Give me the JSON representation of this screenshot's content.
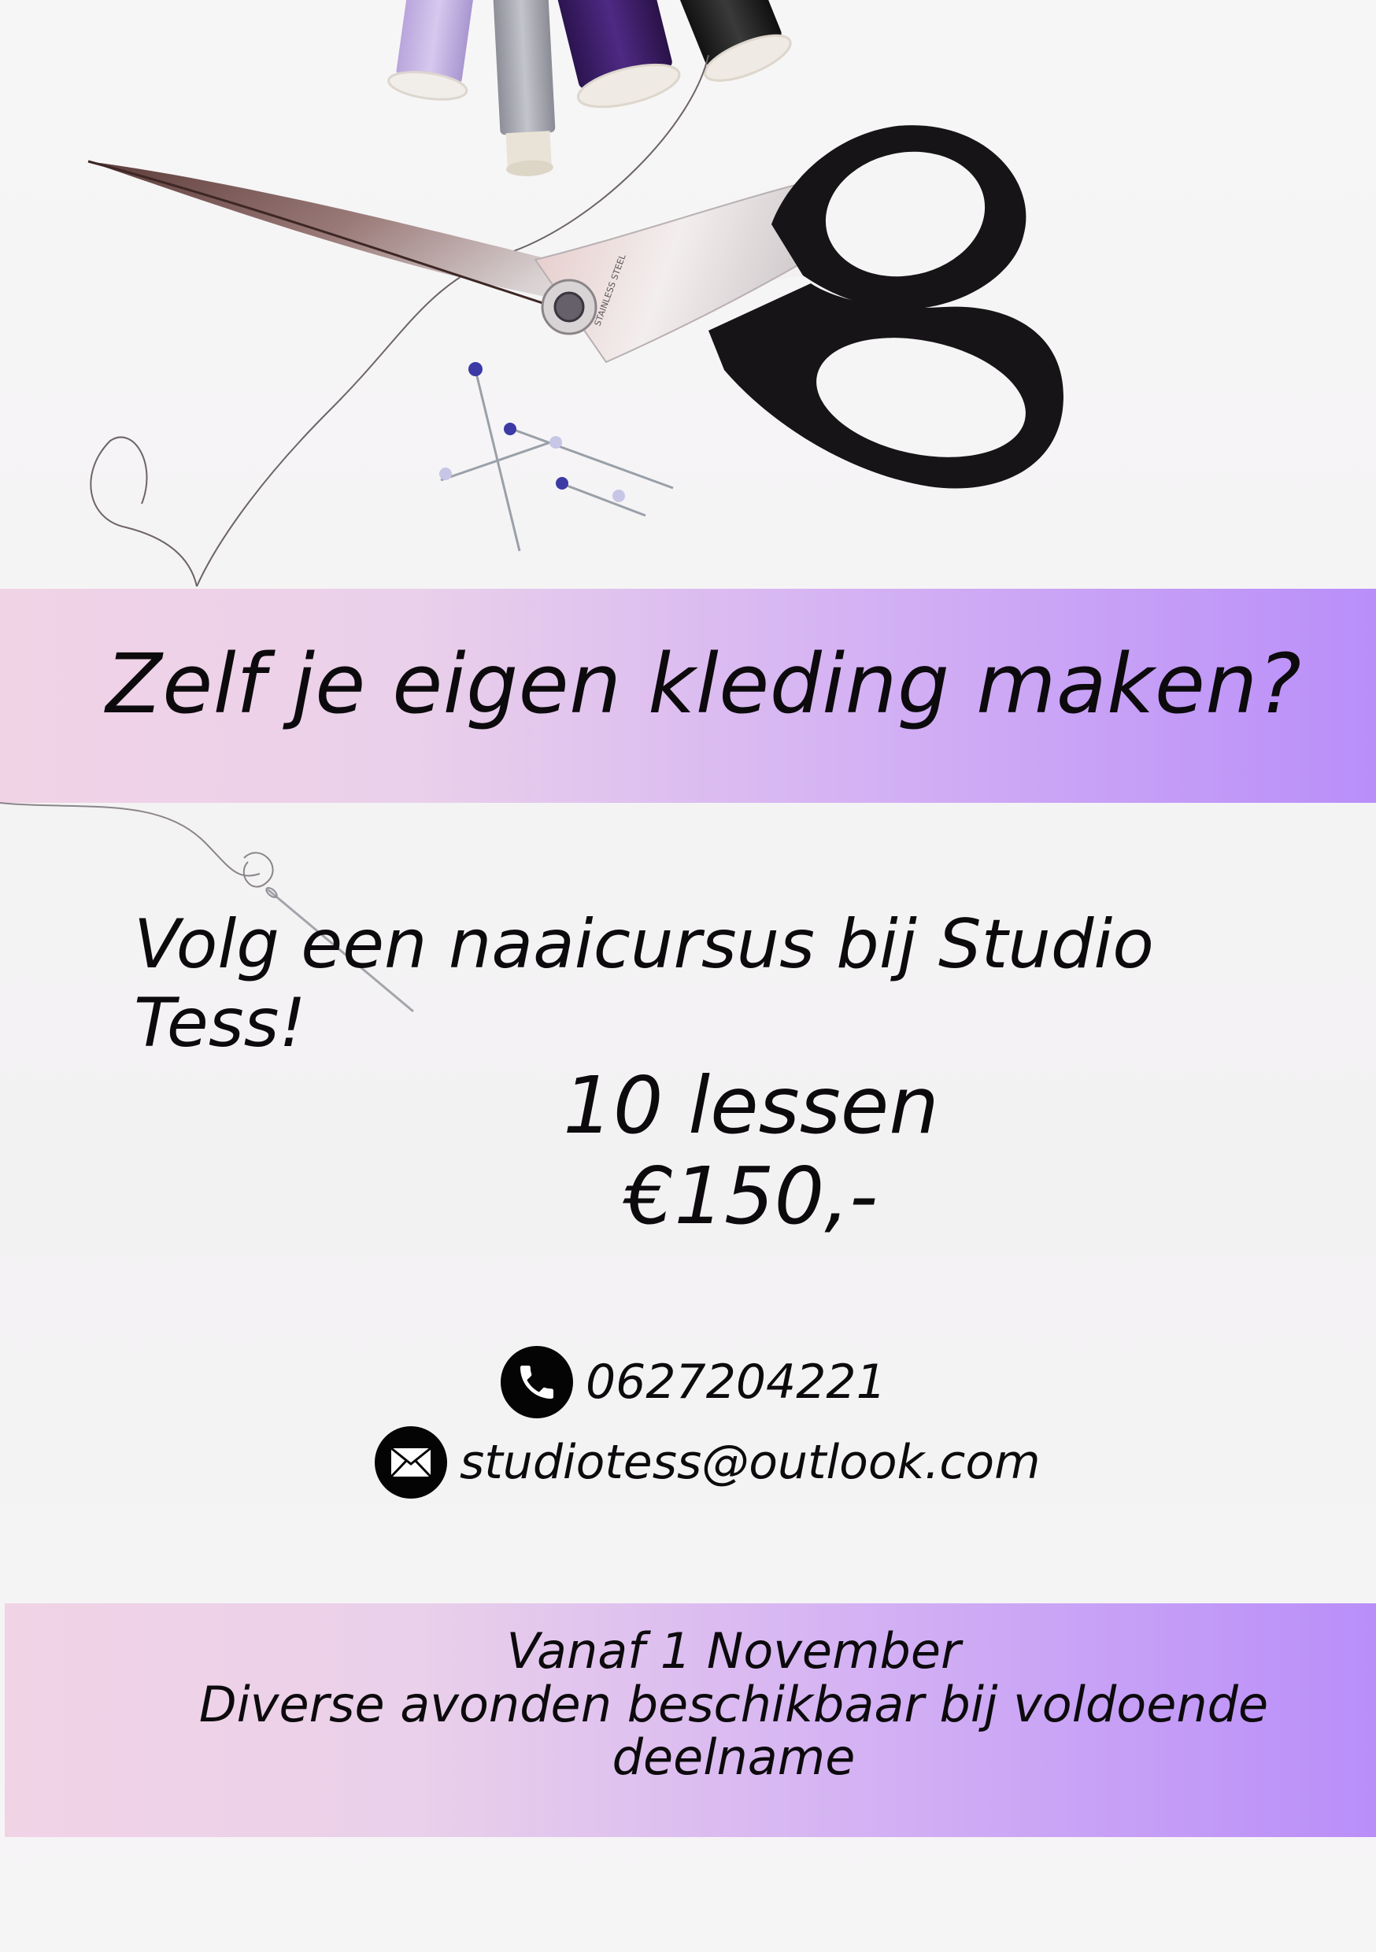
{
  "poster": {
    "headline": "Zelf je eigen kleding maken?",
    "subline": "Volg een naaicursus bij Studio Tess!",
    "lessons": "10 lessen",
    "price": "€150,-",
    "phone": "0627204221",
    "email": "studiotess@outlook.com",
    "start": "Vanaf 1 November",
    "availability_line1": "Diverse avonden beschikbaar bij voldoende",
    "availability_line2": "deelname",
    "scissors_engraving": "STAINLESS STEEL"
  },
  "colors": {
    "band_gradient_start": "#f1d3e6",
    "band_gradient_end": "#b98ef9",
    "text": "#0c0a0c",
    "icon_bg": "#050405"
  },
  "icons": {
    "phone": "phone-icon",
    "email": "envelope-icon",
    "photo": "scissors-and-thread-photo"
  }
}
